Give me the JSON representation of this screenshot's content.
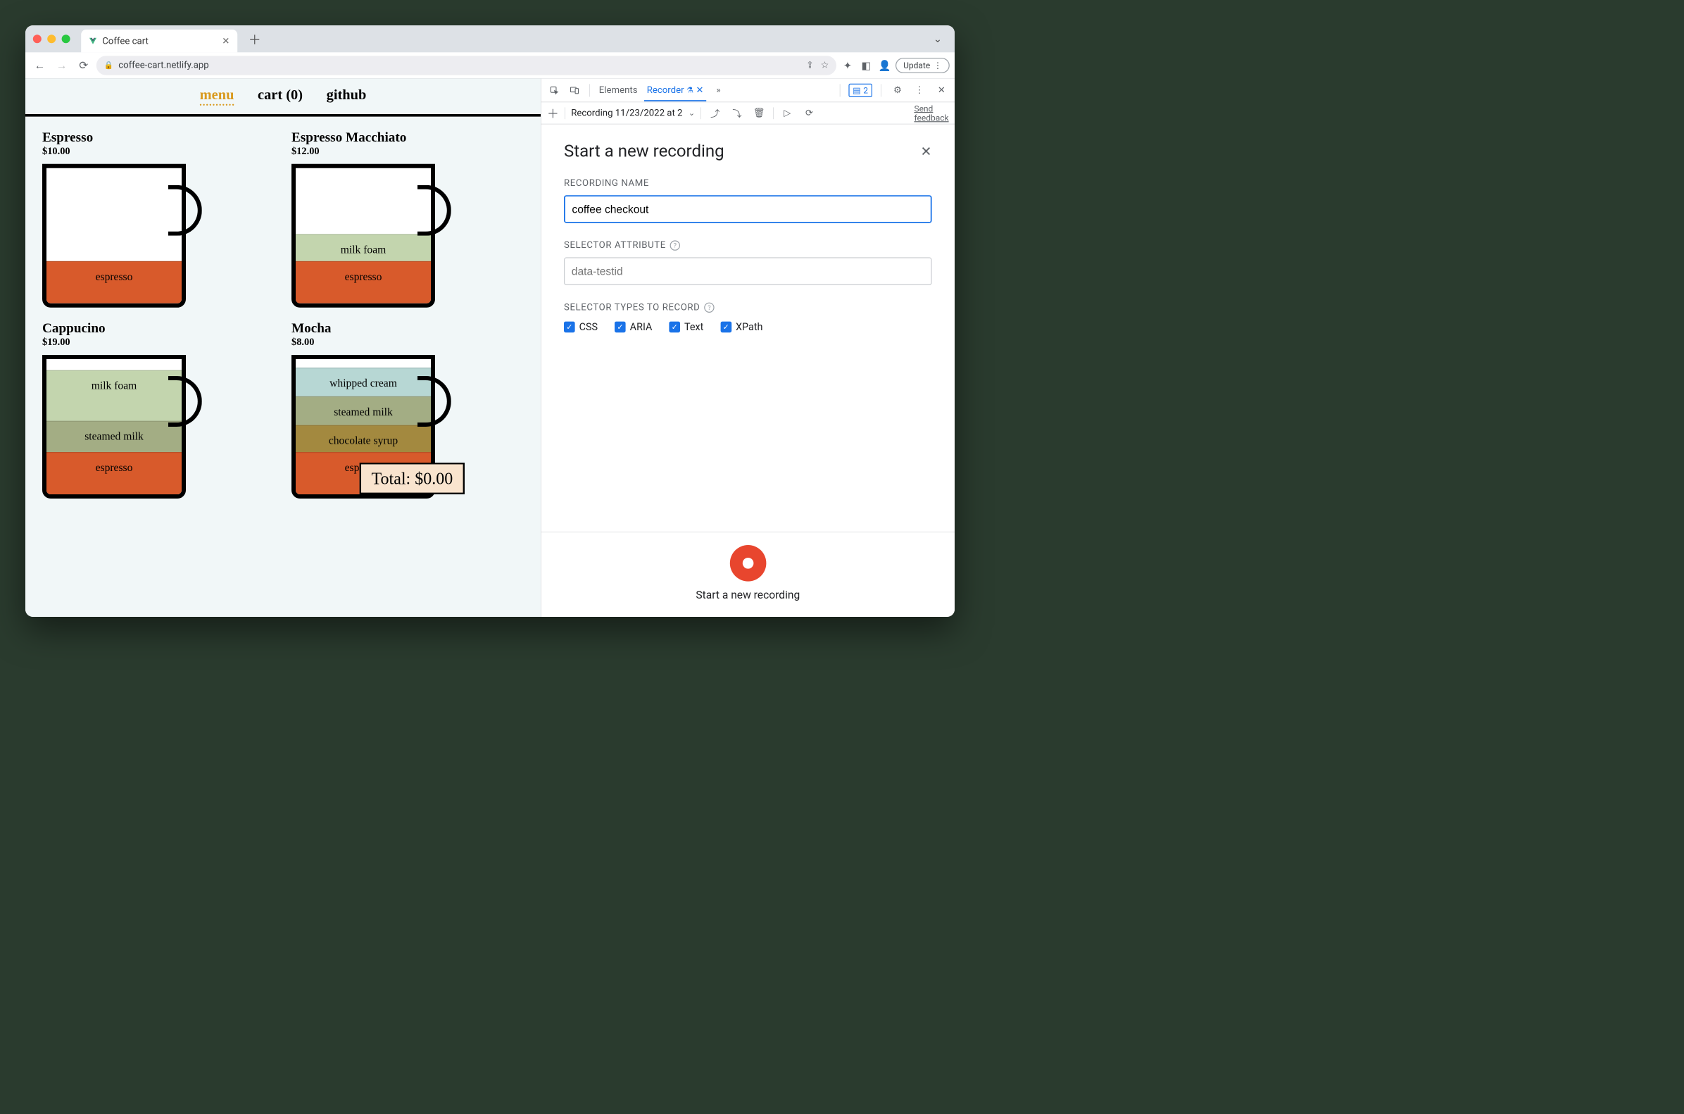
{
  "browser": {
    "tab_title": "Coffee cart",
    "url": "coffee-cart.netlify.app",
    "update_label": "Update"
  },
  "page": {
    "nav": {
      "menu": "menu",
      "cart": "cart (0)",
      "github": "github"
    },
    "items": [
      {
        "name": "Espresso",
        "price": "$10.00",
        "layers": [
          {
            "label": "espresso",
            "class": "l-espresso",
            "h": 100
          }
        ]
      },
      {
        "name": "Espresso Macchiato",
        "price": "$12.00",
        "layers": [
          {
            "label": "milk foam",
            "class": "l-milkfoam",
            "h": 64
          },
          {
            "label": "espresso",
            "class": "l-espresso",
            "h": 100
          }
        ]
      },
      {
        "name": "Cappucino",
        "price": "$19.00",
        "layers": [
          {
            "label": "milk foam",
            "class": "l-milkfoam",
            "h": 120
          },
          {
            "label": "steamed milk",
            "class": "l-steamed",
            "h": 74
          },
          {
            "label": "espresso",
            "class": "l-espresso",
            "h": 100
          }
        ]
      },
      {
        "name": "Mocha",
        "price": "$8.00",
        "layers": [
          {
            "label": "whipped cream",
            "class": "l-cream",
            "h": 68
          },
          {
            "label": "steamed milk",
            "class": "l-steamed",
            "h": 68
          },
          {
            "label": "chocolate syrup",
            "class": "l-choco",
            "h": 64
          },
          {
            "label": "espresso",
            "class": "l-espresso",
            "h": 100
          }
        ]
      }
    ],
    "total_label": "Total: $0.00"
  },
  "devtools": {
    "tabs": {
      "elements": "Elements",
      "recorder": "Recorder"
    },
    "issues_count": "2",
    "toolbar_recording": "Recording 11/23/2022 at 2",
    "feedback": "Send feedback",
    "panel_title": "Start a new recording",
    "labels": {
      "recording_name": "RECORDING NAME",
      "selector_attr": "SELECTOR ATTRIBUTE",
      "selector_types": "SELECTOR TYPES TO RECORD"
    },
    "recording_name_value": "coffee checkout",
    "selector_attr_placeholder": "data-testid",
    "selector_types": [
      "CSS",
      "ARIA",
      "Text",
      "XPath"
    ],
    "footer_label": "Start a new recording"
  }
}
